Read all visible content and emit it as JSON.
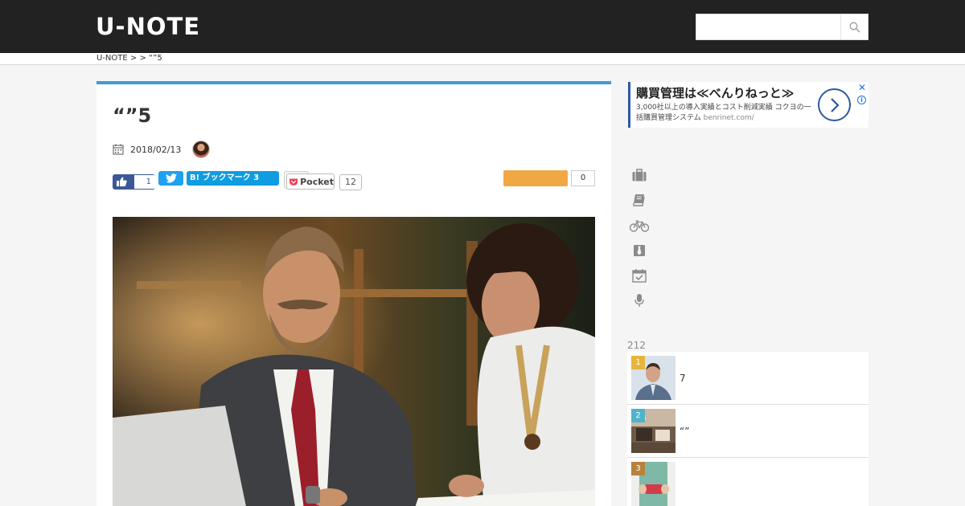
{
  "header": {
    "logo": "U-NOTE",
    "search_placeholder": ""
  },
  "breadcrumb": {
    "text": "U-NOTE >  > “”5"
  },
  "article": {
    "title": "“”5",
    "date": "2018/02/13"
  },
  "share": {
    "facebook_count": "1",
    "hatena_label": "B! ブックマーク 3",
    "pocket_label": "Pocket",
    "pocket_count": "12",
    "orange_count": "0"
  },
  "ad": {
    "title": "購買管理は≪べんりねっと≫",
    "desc": "3,000社以上の導入実績とコスト削減実績 コクヨの一括購買管理システム",
    "url": "benrinet.com/",
    "close": "✕",
    "info": "i"
  },
  "categories": [
    "briefcase-icon",
    "book-icon",
    "bicycle-icon",
    "tie-icon",
    "calendar-check-icon",
    "microphone-icon"
  ],
  "ranking": {
    "count": "212",
    "items": [
      {
        "rank": "1",
        "title": "7",
        "badge_color": "#e7b53b"
      },
      {
        "rank": "2",
        "title": "“”",
        "badge_color": "#4fb3c9"
      },
      {
        "rank": "3",
        "title": "",
        "badge_color": "#b8823d"
      }
    ]
  },
  "colors": {
    "header_bg": "#222222",
    "accent_blue": "#3d9bd6",
    "facebook": "#3b5998",
    "twitter": "#1da1f2",
    "hatena": "#0f9ce1",
    "orange": "#f0a844"
  }
}
